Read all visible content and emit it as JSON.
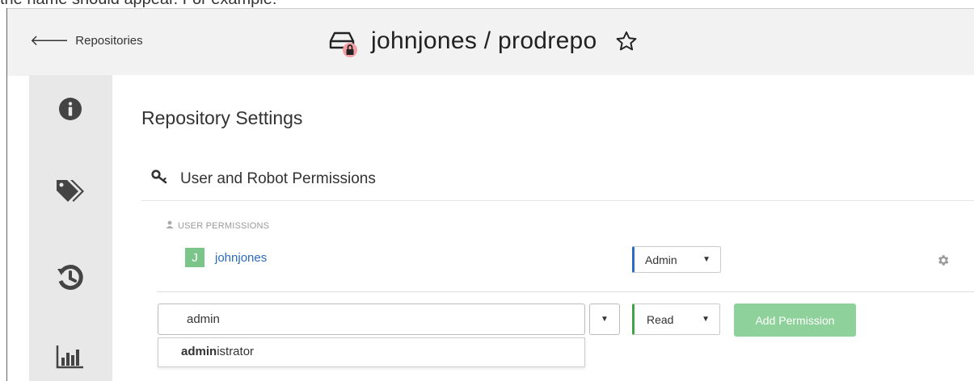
{
  "top_text": "the name should appear. For example:",
  "header": {
    "back_label": "Repositories",
    "title": "johnjones / prodrepo",
    "icons": {
      "back": "arrow-left-icon",
      "repo": "private-repo-lock-icon",
      "star": "star-outline-icon"
    }
  },
  "sidebar": {
    "items": [
      {
        "icon": "info-icon"
      },
      {
        "icon": "tags-icon"
      },
      {
        "icon": "history-icon"
      },
      {
        "icon": "bar-chart-icon"
      }
    ]
  },
  "settings": {
    "page_title": "Repository Settings",
    "section_title": "User and Robot Permissions",
    "user_permissions_label": "USER PERMISSIONS",
    "users": [
      {
        "avatar_letter": "J",
        "name": "johnjones",
        "role": "Admin"
      }
    ],
    "add_form": {
      "input_value": "admin",
      "role": "Read",
      "add_label": "Add Permission",
      "suggestion_match": "admin",
      "suggestion_rest": "istrator"
    }
  },
  "colors": {
    "admin_role_accent": "#2b6cc4",
    "read_role_accent": "#3fa648",
    "add_button": "#8fd19a",
    "avatar": "#7cc58a",
    "link": "#2a6bbf",
    "lock_badge": "#f2a0a6"
  }
}
